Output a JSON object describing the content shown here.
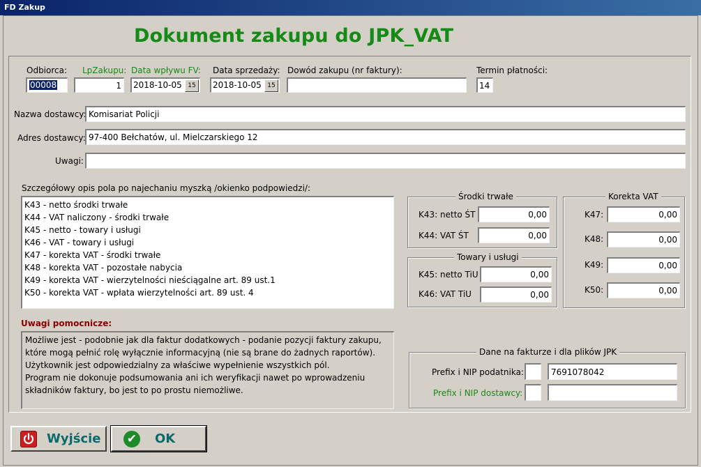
{
  "window": {
    "title": "FD Zakup"
  },
  "heading": "Dokument zakupu do JPK_VAT",
  "header_fields": {
    "odbiorca": {
      "label": "Odbiorca:",
      "value": "00008"
    },
    "lp_zakupu": {
      "label": "LpZakupu:",
      "value": "1"
    },
    "data_wplywu": {
      "label": "Data wpływu FV:",
      "value": "2018-10-05"
    },
    "data_sprzedazy": {
      "label": "Data sprzedaży:",
      "value": "2018-10-05"
    },
    "dowod_zakupu": {
      "label": "Dowód zakupu (nr faktury):",
      "value": ""
    },
    "termin_platnosci": {
      "label": "Termin płatności:",
      "value": "14"
    },
    "calendar_glyph": "15"
  },
  "supplier": {
    "nazwa": {
      "label": "Nazwa dostawcy:",
      "value": "Komisariat Policji"
    },
    "adres": {
      "label": "Adres dostawcy:",
      "value": "97-400 Bełchatów, ul. Mielczarskiego 12"
    },
    "uwagi": {
      "label": "Uwagi:",
      "value": ""
    }
  },
  "description": {
    "label": "Szczegółowy opis pola po najechaniu myszką /okienko podpowiedzi/:",
    "items": [
      "K43 - netto środki trwałe",
      "K44 - VAT naliczony - środki trwałe",
      "K45 - netto - towary i usługi",
      "K46 - VAT - towary i usługi",
      "K47 - korekta VAT - środki trwałe",
      "K48 - korekta VAT - pozostałe nabycia",
      "K49 - korekta VAT - wierzytelności nieściągalne art. 89 ust.1",
      "K50 - korekta VAT - wpłata wierzytelności art. 89 ust. 4"
    ]
  },
  "notes": {
    "title": "Uwagi pomocnicze:",
    "lines": [
      "Możliwe jest - podobnie jak dla faktur dodatkowych - podanie pozycji faktury zakupu,",
      "które mogą pełnić rolę wyłącznie informacyjną (nie są brane do żadnych raportów).",
      "Użytkownik jest odpowiedzialny za właściwe wypełnienie wszystkich pól.",
      "Program nie dokonuje podsumowania ani ich weryfikacji nawet po wprowadzeniu",
      "składników faktury, bo jest to po prostu niemożliwe."
    ]
  },
  "srodki_trwale": {
    "title": "Środki trwałe",
    "k43": {
      "label": "K43: netto ŚT",
      "value": "0,00"
    },
    "k44": {
      "label": "K44: VAT ŚT",
      "value": "0,00"
    }
  },
  "towary_uslugi": {
    "title": "Towary i usługi",
    "k45": {
      "label": "K45: netto TiU",
      "value": "0,00"
    },
    "k46": {
      "label": "K46:  VAT TiU",
      "value": "0,00"
    }
  },
  "korekta_vat": {
    "title": "Korekta VAT",
    "k47": {
      "label": "K47:",
      "value": "0,00"
    },
    "k48": {
      "label": "K48:",
      "value": "0,00"
    },
    "k49": {
      "label": "K49:",
      "value": "0,00"
    },
    "k50": {
      "label": "K50:",
      "value": "0,00"
    }
  },
  "jpk": {
    "title": "Dane na fakturze i dla plików JPK",
    "podatnik": {
      "label": "Prefix i NIP podatnika:",
      "prefix": "",
      "nip": "7691078042"
    },
    "dostawca": {
      "label": "Prefix i NIP dostawcy:",
      "prefix": "",
      "nip": ""
    }
  },
  "buttons": {
    "exit": "Wyjście",
    "ok": "OK"
  },
  "colors": {
    "heading": "#168a16",
    "green_label": "#168a16",
    "notes_title": "#8b0000",
    "button_text": "#0a6a6a",
    "titlebar": "#0a246a"
  }
}
